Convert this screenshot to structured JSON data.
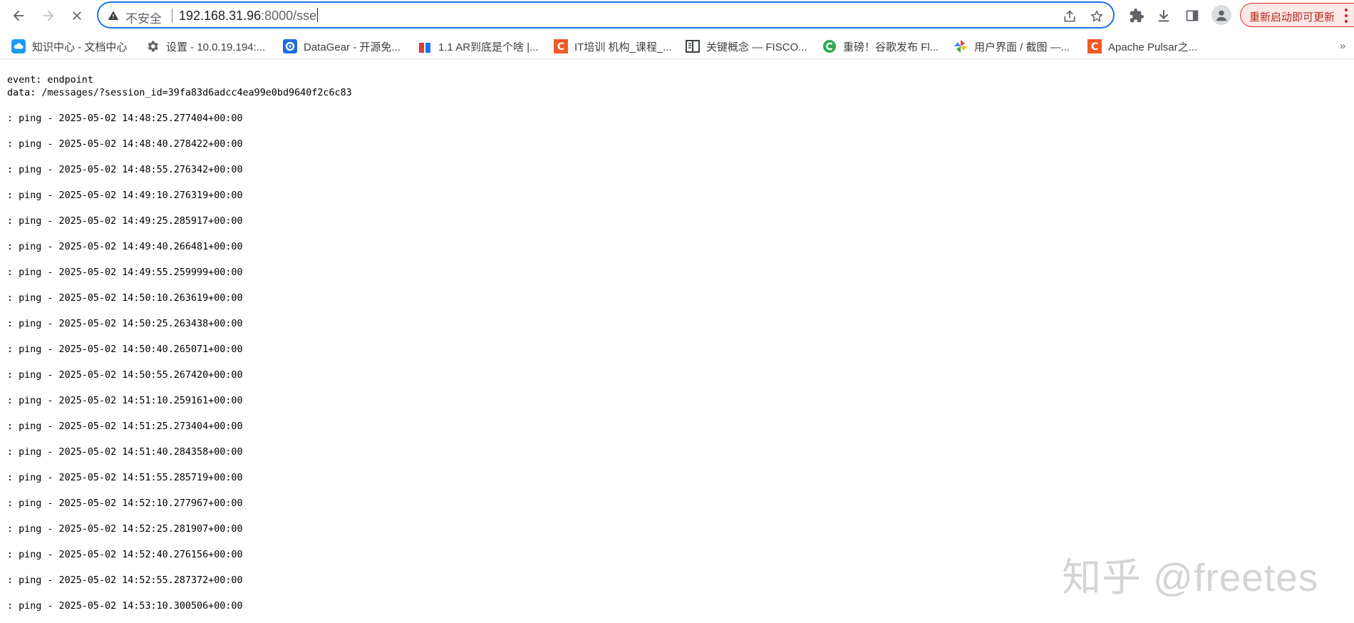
{
  "browser": {
    "omnibox": {
      "insecure_label": "不安全",
      "url_host": "192.168.31.96",
      "url_path": ":8000/sse"
    },
    "update_button_label": "重新启动即可更新",
    "accent_color": "#1a73e8",
    "update_color": "#d93025"
  },
  "bookmarks": [
    {
      "label": "知识中心 - 文档中心",
      "icon": "cloud-icon"
    },
    {
      "label": "设置 - 10.0.19.194:...",
      "icon": "gear-icon"
    },
    {
      "label": "DataGear - 开源免...",
      "icon": "datagear-icon"
    },
    {
      "label": "1.1 AR到底是个啥 |...",
      "icon": "gift-icon"
    },
    {
      "label": "IT培训 机构_课程_...",
      "icon": "c-icon"
    },
    {
      "label": "关键概念 — FISCO...",
      "icon": "book-icon"
    },
    {
      "label": "重磅！谷歌发布 Fl...",
      "icon": "c-green-icon"
    },
    {
      "label": "用户界面 / 截图 —...",
      "icon": "pinwheel-icon"
    },
    {
      "label": "Apache Pulsar之...",
      "icon": "c-icon"
    }
  ],
  "stream": {
    "event_line": "event: endpoint",
    "data_line": "data: /messages/?session_id=39fa83d6adcc4ea99e0bd9640f2c6c83",
    "pings": [
      ": ping - 2025-05-02 14:48:25.277404+00:00",
      ": ping - 2025-05-02 14:48:40.278422+00:00",
      ": ping - 2025-05-02 14:48:55.276342+00:00",
      ": ping - 2025-05-02 14:49:10.276319+00:00",
      ": ping - 2025-05-02 14:49:25.285917+00:00",
      ": ping - 2025-05-02 14:49:40.266481+00:00",
      ": ping - 2025-05-02 14:49:55.259999+00:00",
      ": ping - 2025-05-02 14:50:10.263619+00:00",
      ": ping - 2025-05-02 14:50:25.263438+00:00",
      ": ping - 2025-05-02 14:50:40.265071+00:00",
      ": ping - 2025-05-02 14:50:55.267420+00:00",
      ": ping - 2025-05-02 14:51:10.259161+00:00",
      ": ping - 2025-05-02 14:51:25.273404+00:00",
      ": ping - 2025-05-02 14:51:40.284358+00:00",
      ": ping - 2025-05-02 14:51:55.285719+00:00",
      ": ping - 2025-05-02 14:52:10.277967+00:00",
      ": ping - 2025-05-02 14:52:25.281907+00:00",
      ": ping - 2025-05-02 14:52:40.276156+00:00",
      ": ping - 2025-05-02 14:52:55.287372+00:00",
      ": ping - 2025-05-02 14:53:10.300506+00:00"
    ]
  },
  "watermark": "知乎 @freetes"
}
